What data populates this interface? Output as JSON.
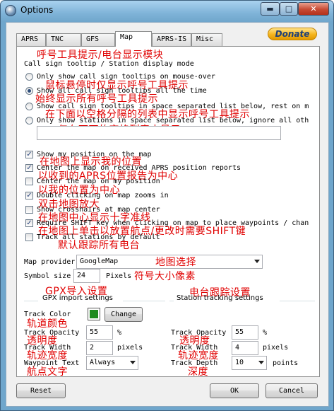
{
  "window": {
    "title": "Options",
    "minimize": "▬",
    "maximize": "□",
    "close": "✕"
  },
  "tabs": [
    "APRS",
    "TNC",
    "GFS",
    "Map",
    "APRS-IS",
    "Misc"
  ],
  "donate": "Donate",
  "header": {
    "annotation": "呼号工具提示/电台显示模块",
    "label": "Call sign tooltip / Station display mode"
  },
  "radio_options": [
    {
      "label": "Only show call sign tooltips on mouse-over",
      "selected": false,
      "annotation": "鼠标悬停时仅显示呼号工具提示"
    },
    {
      "label": "Show all call sign tooltips all the time",
      "selected": true,
      "annotation": "始终显示所有呼号工具提示"
    },
    {
      "label": "Show call sign tooltips in space separated list below, rest on m",
      "selected": false,
      "annotation": "在下面以空格分隔的列表中显示呼号工具提示"
    },
    {
      "label": "Only show stations in space separated list below, ignore all oth",
      "selected": false,
      "annotation": "仅在下面的空格列表中显示"
    }
  ],
  "station_list_value": "",
  "checkboxes": [
    {
      "label": "Show my position on the map",
      "checked": true,
      "annotation": "在地图上显示我的位置"
    },
    {
      "label": "Center the map on received APRS position reports",
      "checked": true,
      "annotation": "以收到的APRS位置报告为中心"
    },
    {
      "label": "Center the map on my position",
      "checked": false,
      "annotation": "以我的位置为中心"
    },
    {
      "label": "Double clicking on map zooms in",
      "checked": true,
      "annotation": "双击地图放大"
    },
    {
      "label": "Show crosshairs at map center",
      "checked": false,
      "annotation": "在地图中心显示十字准线"
    },
    {
      "label": "Require SHIFT key when clicking on map to place waypoints / chan",
      "checked": true,
      "annotation": "在地图上单击以放置航点/更改时需要SHIFT键"
    },
    {
      "label": "Track all stations by default",
      "checked": false,
      "annotation": "默认跟踪所有电台"
    }
  ],
  "map_provider": {
    "label": "Map provider",
    "value": "GoogleMap",
    "annotation": "地图选择"
  },
  "symbol_size": {
    "label": "Symbol size",
    "value": "24",
    "unit": "Pixels",
    "annotation": "符号大小像素"
  },
  "gpx": {
    "annotation": "GPX导入设置",
    "title": "GPX import settings",
    "track_color_label": "Track Color",
    "track_color": "#1f8a1f",
    "track_color_annotation": "轨道颜色",
    "change_button": "Change",
    "opacity_label": "Track Opacity",
    "opacity_value": "55",
    "opacity_unit": "%",
    "opacity_annotation": "透明度",
    "width_label": "Track Width",
    "width_value": "2",
    "width_unit": "pixels",
    "width_annotation": "轨迹宽度",
    "waypoint_label": "Waypoint Text",
    "waypoint_value": "Always",
    "waypoint_annotation": "航点文字"
  },
  "station_tracking": {
    "annotation": "电台跟踪设置",
    "title": "Station tracking settings",
    "opacity_label": "Track Opacity",
    "opacity_value": "55",
    "opacity_unit": "%",
    "opacity_annotation": "透明度",
    "width_label": "Track Width",
    "width_value": "4",
    "width_unit": "pixels",
    "width_annotation": "轨迹宽度",
    "depth_label": "Track Depth",
    "depth_value": "10",
    "depth_unit": "points",
    "depth_annotation": "深度"
  },
  "footer": {
    "reset": "Reset",
    "ok": "OK",
    "cancel": "Cancel"
  }
}
